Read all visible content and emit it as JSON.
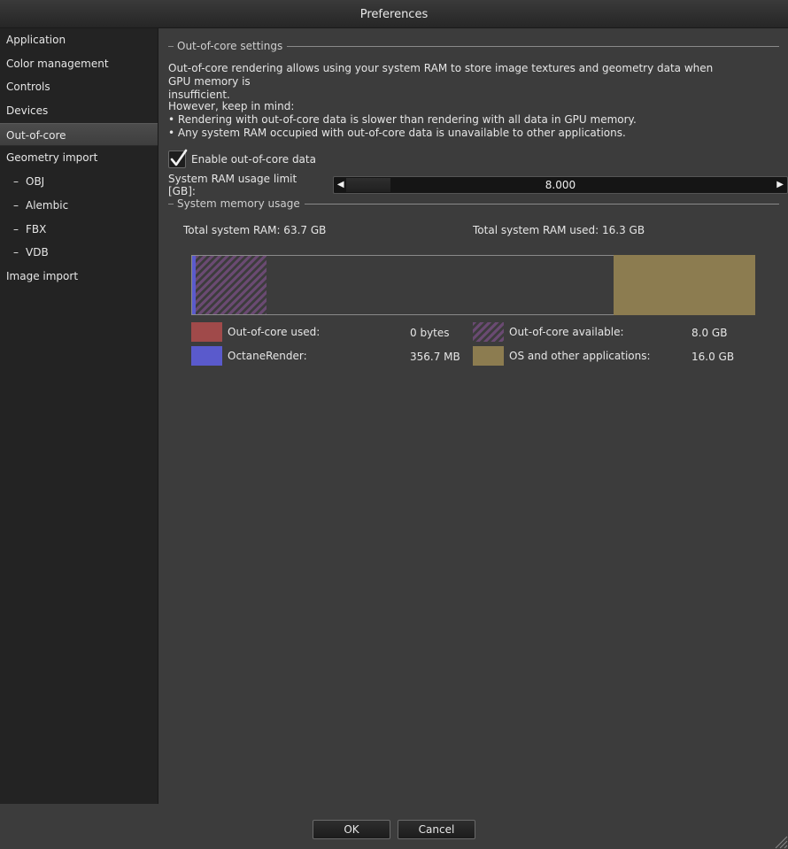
{
  "window": {
    "title": "Preferences"
  },
  "sidebar": {
    "items": [
      {
        "label": "Application"
      },
      {
        "label": "Color management"
      },
      {
        "label": "Controls"
      },
      {
        "label": "Devices"
      },
      {
        "label": "Out-of-core"
      },
      {
        "label": "Geometry import"
      },
      {
        "label": "OBJ"
      },
      {
        "label": "Alembic"
      },
      {
        "label": "FBX"
      },
      {
        "label": "VDB"
      },
      {
        "label": "Image import"
      }
    ],
    "sub_prefix": "–",
    "selected": "Out-of-core"
  },
  "ooc_settings": {
    "heading": "Out-of-core settings",
    "description_1": "Out-of-core rendering allows using your system RAM to store image textures and geometry data when GPU memory is",
    "description_2": "insufficient.",
    "keep_in_mind": "However, keep in mind:",
    "bullet_1": "• Rendering with out-of-core data is slower than rendering with all data in GPU memory.",
    "bullet_2": "• Any system RAM occupied with out-of-core data is unavailable to other applications.",
    "enable_label": "Enable out-of-core data",
    "enable_checked": true,
    "limit_label": "System RAM usage limit [GB]:",
    "limit_value": "8.000",
    "arrow_left": "◀",
    "arrow_right": "▶"
  },
  "memory": {
    "heading": "System memory usage",
    "total_label": "Total system RAM: 63.7 GB",
    "used_label": "Total system RAM used: 16.3 GB",
    "usage_fractions": {
      "octane_render": 0.0056,
      "out_of_core_available": 0.1256,
      "os_and_other": 0.2512
    },
    "legend": [
      {
        "label": "Out-of-core used:",
        "value": "0 bytes",
        "color": "#a04a4a"
      },
      {
        "label": "Out-of-core available:",
        "value": "8.0 GB",
        "color": "#6a4a72"
      },
      {
        "label": "OctaneRender:",
        "value": "356.7 MB",
        "color": "#5a5acc"
      },
      {
        "label": "OS and other applications:",
        "value": "16.0 GB",
        "color": "#8c7c50"
      }
    ]
  },
  "buttons": {
    "ok": "OK",
    "cancel": "Cancel"
  }
}
